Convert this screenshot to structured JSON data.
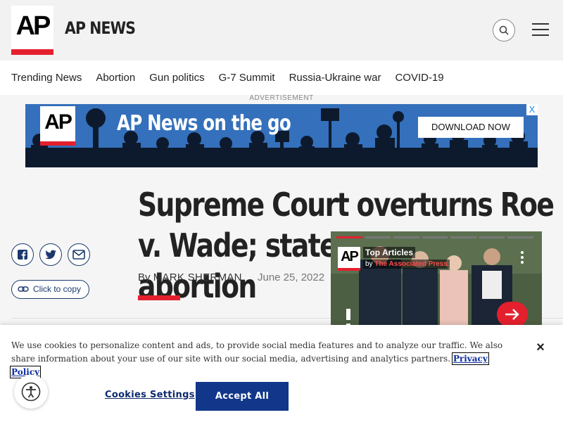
{
  "header": {
    "logo_text": "AP",
    "site_name": "AP NEWS",
    "icons": {
      "search": "search-icon",
      "menu": "hamburger-menu-icon"
    }
  },
  "nav": {
    "items": [
      "Trending News",
      "Abortion",
      "Gun politics",
      "G-7 Summit",
      "Russia-Ukraine war",
      "COVID-19"
    ]
  },
  "ad": {
    "label": "ADVERTISEMENT",
    "logo_text": "AP",
    "headline": "AP News on the go",
    "cta": "DOWNLOAD NOW",
    "close": "X"
  },
  "article": {
    "headline": "Supreme Court overturns Roe v. Wade; states can ban abortion",
    "byline_prefix": "By",
    "author": "MARK SHERMAN",
    "date": "June 25, 2022",
    "copy_label": "Click to copy",
    "share_icons": [
      "facebook-icon",
      "twitter-icon",
      "email-icon"
    ]
  },
  "video": {
    "logo_text": "AP",
    "title": "Top Articles",
    "by_prefix": "by",
    "source": "The Associated Press"
  },
  "cookie": {
    "text": "We use cookies to personalize content and ads, to provide social media features and to analyze our traffic. We also share information about your use of our site with our social media, advertising and analytics partners.",
    "policy_link": "Privacy Policy",
    "settings_label": "Cookies Settings",
    "accept_label": "Accept All Cookies",
    "close": "×"
  },
  "colors": {
    "accent": "#e4202e",
    "link": "#0d2ea0",
    "button": "#12378a"
  }
}
